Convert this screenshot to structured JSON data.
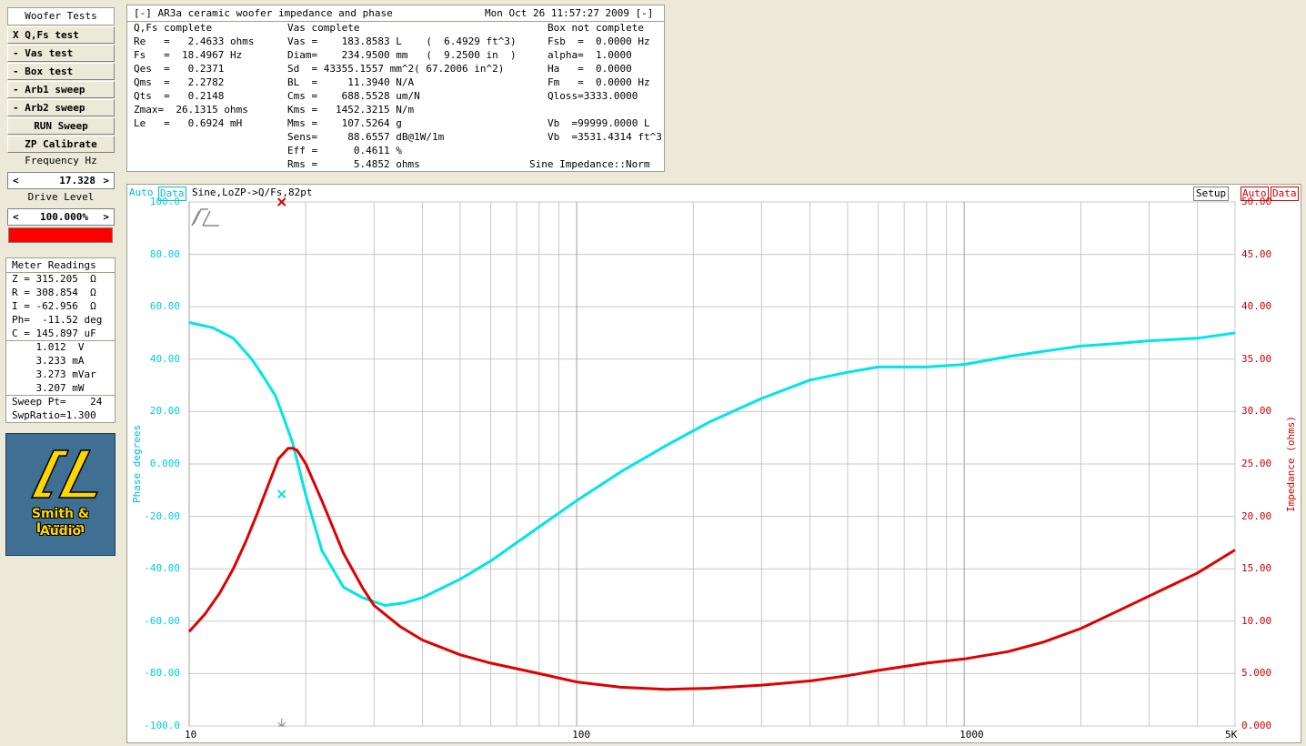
{
  "sidebar": {
    "title": "Woofer Tests",
    "buttons": [
      {
        "label": "X Q,Fs test"
      },
      {
        "label": "- Vas test"
      },
      {
        "label": "- Box test"
      },
      {
        "label": "- Arb1 sweep"
      },
      {
        "label": "- Arb2 sweep"
      },
      {
        "label": "RUN Sweep"
      },
      {
        "label": "ZP Calibrate"
      }
    ],
    "freq_label": "Frequency Hz",
    "freq_value": "17.328",
    "drive_label": "Drive Level",
    "drive_value": "100.000%",
    "left_arrow": "<",
    "right_arrow": ">",
    "drive_color": "#ff0000"
  },
  "meter": {
    "title": "Meter Readings",
    "rows": [
      "Z = 315.205  Ω",
      "R = 308.854  Ω",
      "I = -62.956  Ω",
      "Ph=  -11.52 deg",
      "C = 145.897 uF",
      "    1.012  V",
      "    3.233 mA",
      "    3.273 mVar",
      "    3.207 mW"
    ],
    "sweep_pt": "Sweep Pt=    24",
    "sweep_ratio": "SwpRatio=1.300"
  },
  "logo": {
    "line1": "Smith & Larson",
    "line2": "Audio"
  },
  "info": {
    "header_left": "[-] AR3a ceramic woofer impedance and phase",
    "header_right": "Mon Oct 26 11:57:27 2009 [-]",
    "col1": {
      "title": "Q,Fs complete",
      "rows": [
        "Re   =   2.4633 ohms",
        "Fs   =  18.4967 Hz",
        "Qes  =   0.2371",
        "Qms  =   2.2782",
        "Qts  =   0.2148",
        "Zmax=  26.1315 ohms",
        "Le   =   0.6924 mH"
      ]
    },
    "col2": {
      "title": "Vas complete",
      "rows": [
        "Vas =    183.8583 L    (  6.4929 ft^3)",
        "Diam=    234.9500 mm   (  9.2500 in  )",
        "Sd  = 43355.1557 mm^2( 67.2006 in^2)",
        "BL  =     11.3940 N/A",
        "Cms =    688.5528 um/N",
        "Kms =   1452.3215 N/m",
        "Mms =    107.5264 g",
        "Sens=     88.6557 dB@1W/1m",
        "Eff =      0.4611 %",
        "Rms =      5.4852 ohms"
      ]
    },
    "col3": {
      "title": "Box not complete",
      "rows": [
        "Fsb  =  0.0000 Hz",
        "alpha=  1.0000",
        "Ha   =  0.0000",
        "Fm   =  0.0000 Hz",
        "Qloss=3333.0000",
        "",
        "Vb  =99999.0000 L",
        "Vb  =3531.4314 ft^3"
      ]
    },
    "footer": "Sine Impedance::Norm"
  },
  "graph": {
    "auto": "Auto",
    "data": "Data",
    "caption": "Sine,LoZP->Q/Fs,82pt",
    "setup": "Setup",
    "left_axis_label": "Phase degrees",
    "right_axis_label": "Impedance (ohms)",
    "phase_color": "#00e5e5",
    "impedance_color": "#e00000"
  },
  "chart_data": {
    "type": "line",
    "x_scale": "log",
    "xlim": [
      10,
      5000
    ],
    "x_ticks": [
      "10",
      "100",
      "1000",
      "5K"
    ],
    "y_left": {
      "label": "Phase degrees",
      "lim": [
        -100,
        100
      ],
      "ticks": [
        "100.0",
        "80.00",
        "60.00",
        "40.00",
        "20.00",
        "0.000",
        "-20.00",
        "-40.00",
        "-60.00",
        "-80.00",
        "-100.0"
      ]
    },
    "y_right": {
      "label": "Impedance (ohms)",
      "lim": [
        0,
        50
      ],
      "ticks": [
        "50.00",
        "45.00",
        "40.00",
        "35.00",
        "30.00",
        "25.00",
        "20.00",
        "15.00",
        "10.00",
        "5.000",
        "0.000"
      ]
    },
    "series": [
      {
        "axis": "left",
        "x": [
          10,
          11.5,
          13,
          14.5,
          15.6,
          16.7,
          17.5,
          18.5,
          20,
          22,
          25,
          28,
          32,
          36,
          40,
          50,
          60,
          80,
          100,
          130,
          170,
          220,
          300,
          400,
          500,
          600,
          800,
          1000,
          1300,
          1600,
          2000,
          2500,
          3000,
          4000,
          5000
        ],
        "y": [
          54,
          52,
          48,
          40,
          33,
          26,
          18,
          8,
          -12,
          -33,
          -47,
          -51,
          -54,
          -53,
          -51,
          -44,
          -37,
          -24,
          -14,
          -3,
          7,
          16,
          25,
          32,
          35,
          37,
          37,
          38,
          41,
          43,
          45,
          46,
          47,
          48,
          50
        ]
      },
      {
        "axis": "right",
        "x": [
          10,
          11,
          12,
          13,
          14,
          15,
          16,
          17,
          17.5,
          18,
          18.5,
          19,
          20,
          22,
          25,
          28,
          30,
          35,
          40,
          50,
          60,
          80,
          100,
          130,
          170,
          220,
          300,
          400,
          500,
          600,
          800,
          1000,
          1300,
          1600,
          2000,
          2500,
          3000,
          4000,
          5000
        ],
        "y": [
          9,
          10.7,
          12.7,
          15,
          17.6,
          20.3,
          23,
          25.5,
          26,
          26.5,
          26.5,
          26.3,
          25,
          21.5,
          16.5,
          13.2,
          11.5,
          9.5,
          8.2,
          6.8,
          6,
          5,
          4.2,
          3.7,
          3.5,
          3.6,
          3.9,
          4.3,
          4.8,
          5.3,
          6,
          6.4,
          7.1,
          8,
          9.3,
          11,
          12.4,
          14.6,
          16.8
        ]
      }
    ],
    "markers": [
      {
        "axis": "right",
        "x": 17.328,
        "y": 50.5,
        "color": "#e00000"
      },
      {
        "axis": "left",
        "x": 17.328,
        "y": -11.5,
        "color": "#00e5e5"
      }
    ]
  }
}
